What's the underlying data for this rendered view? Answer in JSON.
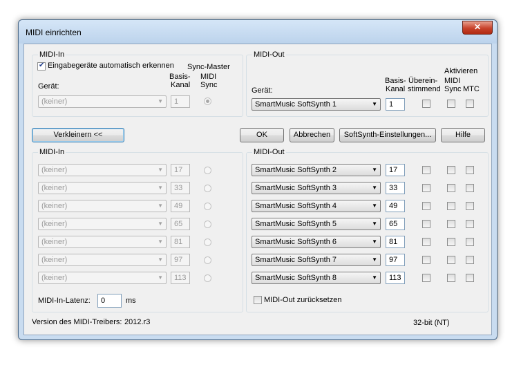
{
  "window": {
    "title": "MIDI einrichten",
    "close_symbol": "✕"
  },
  "top_in": {
    "group_title": "MIDI-In",
    "auto_detect_label": "Eingabegeräte automatisch erkennen",
    "auto_detect_checked": true,
    "sync_master_label": "Sync-Master",
    "device_label": "Gerät:",
    "basis_label_1": "Basis-",
    "basis_label_2": "Kanal",
    "midi_sync_label_1": "MIDI",
    "midi_sync_label_2": "Sync",
    "device_value": "(keiner)",
    "channel_value": "1"
  },
  "top_out": {
    "group_title": "MIDI-Out",
    "device_label": "Gerät:",
    "basis_label_1": "Basis-",
    "basis_label_2": "Kanal",
    "uebereinstimmend_1": "Überein-",
    "uebereinstimmend_2": "stimmend",
    "aktivieren_label": "Aktivieren",
    "midi_sync_label_1": "MIDI",
    "midi_sync_label_2": "Sync",
    "mtc_label": "MTC",
    "device_value": "SmartMusic SoftSynth 1",
    "channel_value": "1"
  },
  "buttons": {
    "collapse": "Verkleinern <<",
    "ok": "OK",
    "cancel": "Abbrechen",
    "softsynth": "SoftSynth-Einstellungen...",
    "help": "Hilfe"
  },
  "bottom_in": {
    "group_title": "MIDI-In",
    "rows": [
      {
        "device": "(keiner)",
        "channel": "17"
      },
      {
        "device": "(keiner)",
        "channel": "33"
      },
      {
        "device": "(keiner)",
        "channel": "49"
      },
      {
        "device": "(keiner)",
        "channel": "65"
      },
      {
        "device": "(keiner)",
        "channel": "81"
      },
      {
        "device": "(keiner)",
        "channel": "97"
      },
      {
        "device": "(keiner)",
        "channel": "113"
      }
    ],
    "latency_label": "MIDI-In-Latenz:",
    "latency_value": "0",
    "latency_unit": "ms"
  },
  "bottom_out": {
    "group_title": "MIDI-Out",
    "rows": [
      {
        "device": "SmartMusic SoftSynth 2",
        "channel": "17"
      },
      {
        "device": "SmartMusic SoftSynth 3",
        "channel": "33"
      },
      {
        "device": "SmartMusic SoftSynth 4",
        "channel": "49"
      },
      {
        "device": "SmartMusic SoftSynth 5",
        "channel": "65"
      },
      {
        "device": "SmartMusic SoftSynth 6",
        "channel": "81"
      },
      {
        "device": "SmartMusic SoftSynth 7",
        "channel": "97"
      },
      {
        "device": "SmartMusic SoftSynth 8",
        "channel": "113"
      }
    ],
    "reset_label": "MIDI-Out zurücksetzen"
  },
  "footer": {
    "version_label": "Version des MIDI-Treibers:",
    "version_value": "2012.r3",
    "bitness": "32-bit (NT)"
  },
  "icons": {
    "dropdown": "chevron-down-icon",
    "close": "close-icon"
  }
}
